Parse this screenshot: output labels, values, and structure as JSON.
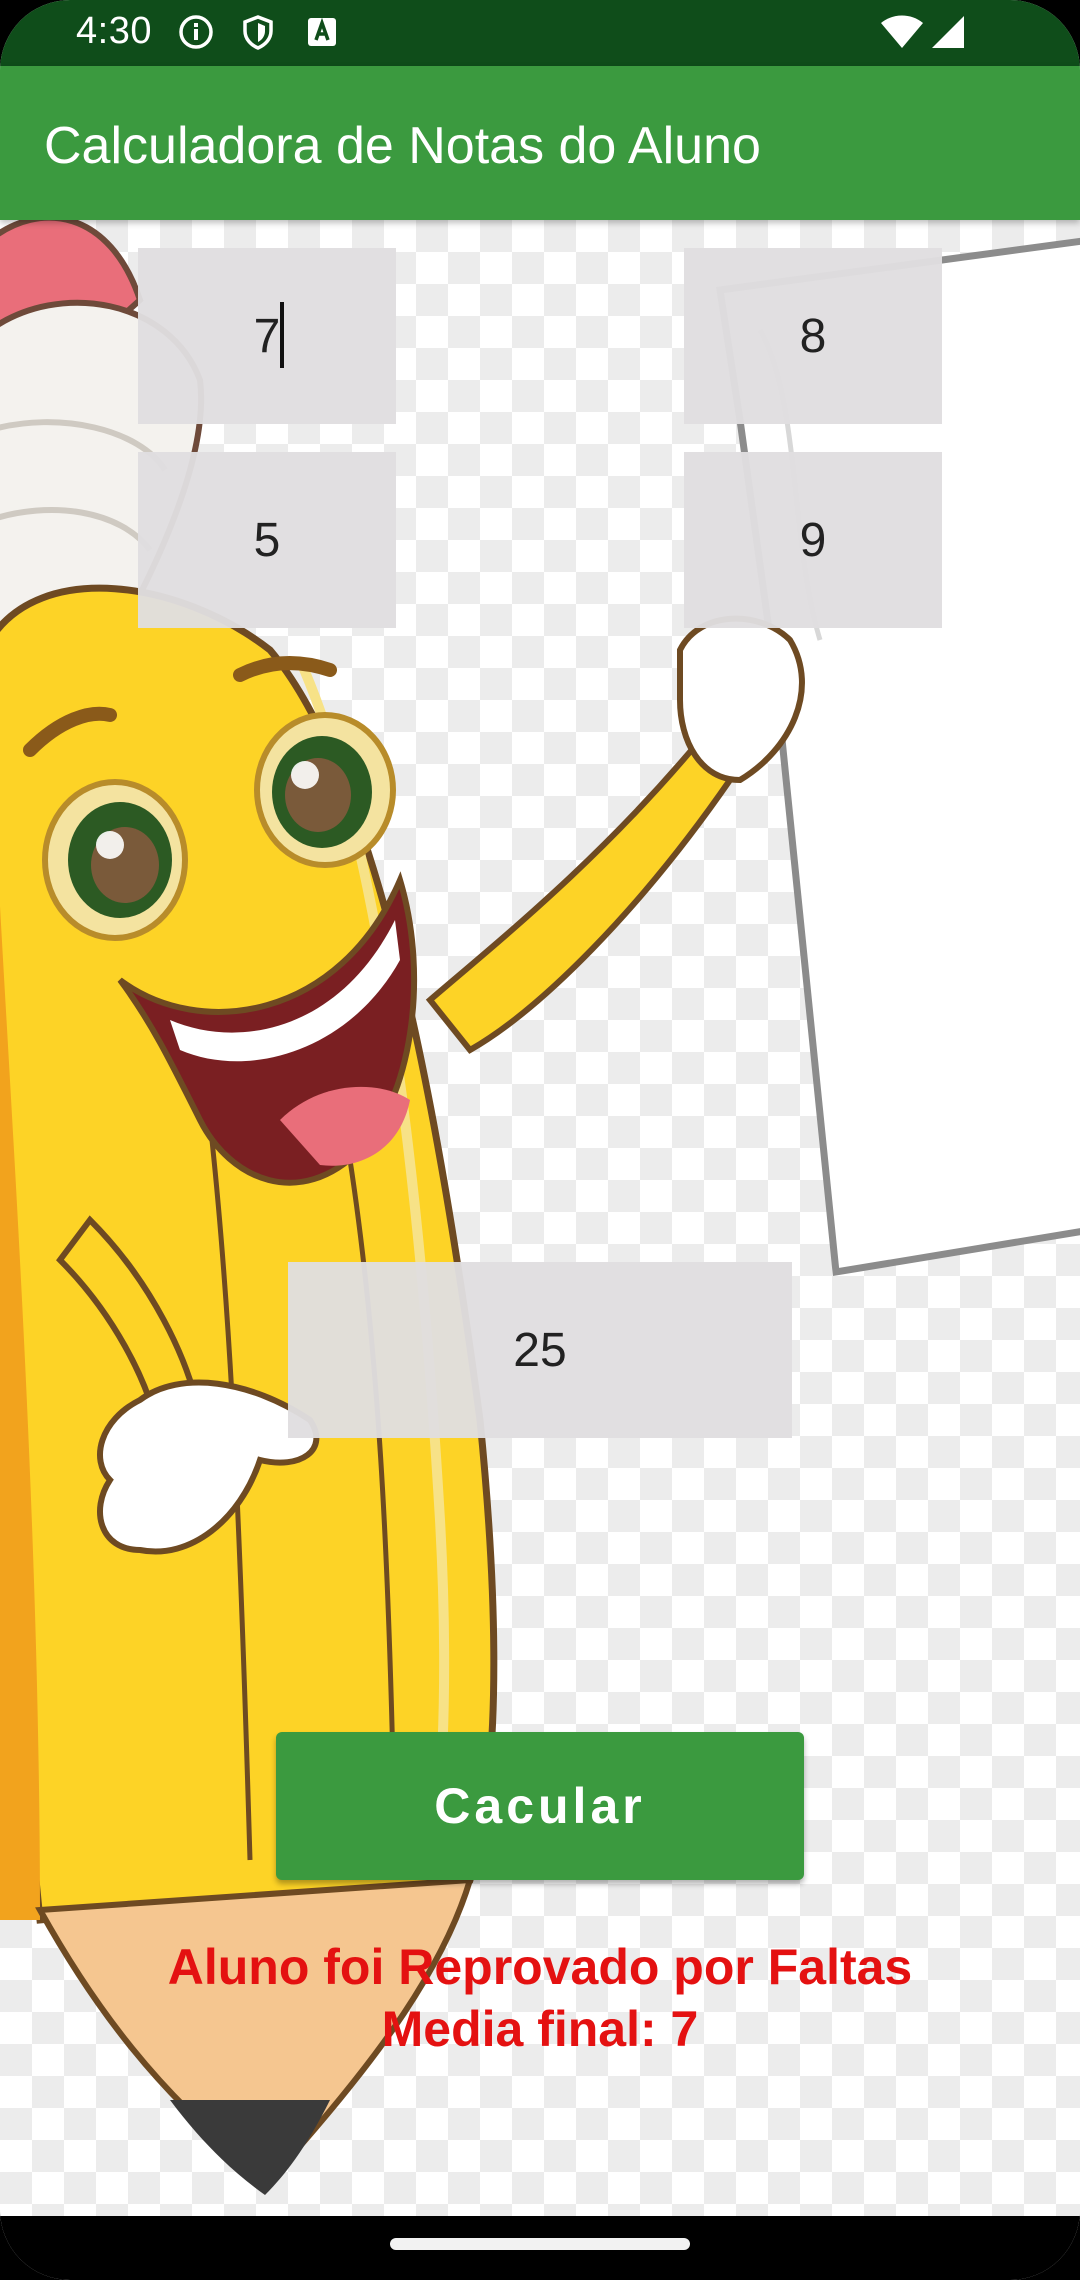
{
  "status_bar": {
    "time": "4:30",
    "left_icons": [
      "info-icon",
      "shield-icon",
      "keyboard-a-icon"
    ],
    "right_icons": [
      "wifi-icon",
      "signal-icon"
    ]
  },
  "app_bar": {
    "title": "Calculadora de Notas do Aluno",
    "color": "#3b9a3f"
  },
  "grades": [
    {
      "value": "7"
    },
    {
      "value": "8"
    },
    {
      "value": "5"
    },
    {
      "value": "9"
    }
  ],
  "absences": {
    "value": "25"
  },
  "calculate_button": {
    "label": "Cacular"
  },
  "result": {
    "status": "Aluno foi Reprovado por Faltas",
    "average": "Media final: 7",
    "color": "#e41111"
  },
  "background": {
    "illustration": "pencil-mascot-illustration"
  }
}
